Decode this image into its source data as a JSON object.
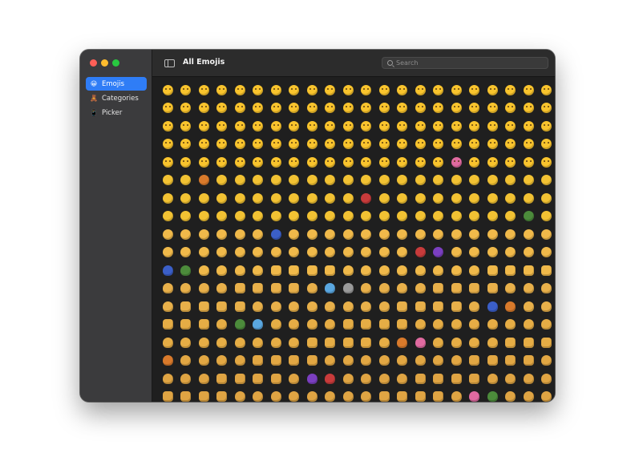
{
  "window": {
    "traffic_lights": [
      "close",
      "minimize",
      "zoom"
    ]
  },
  "sidebar": {
    "items": [
      {
        "label": "Emojis",
        "icon": "grinning-face-icon",
        "glyph": "😀",
        "active": true
      },
      {
        "label": "Categories",
        "icon": "teddy-bear-icon",
        "glyph": "🧸",
        "active": false
      },
      {
        "label": "Picker",
        "icon": "phone-icon",
        "glyph": "📱",
        "active": false
      }
    ]
  },
  "toolbar": {
    "title": "All Emojis",
    "sidebar_toggle_icon": "sidebar-toggle-icon",
    "search": {
      "placeholder": "Search",
      "value": "",
      "icon": "search-icon"
    }
  },
  "grid": {
    "columns": 22,
    "row_colors": [
      "#f9c42d",
      "#f9c42d",
      "#f9c42d",
      "#f9c42d",
      "#f9c42d",
      "#f2c233",
      "#f2c233",
      "#f2c233",
      "#f0b94a",
      "#f0b94a",
      "#f0b94a",
      "#e8b04a",
      "#e8b04a",
      "#e6ad45",
      "#e6ad45",
      "#e2a743",
      "#dfa443",
      "#dfa443",
      "#d9a046"
    ],
    "accent_colors": [
      "#7b3fc0",
      "#c83b3b",
      "#5aa7e0",
      "#4c8b3b",
      "#e06aa0",
      "#9a9a9a",
      "#3b5fc8",
      "#d97a2b"
    ]
  },
  "colors": {
    "accent": "#2f7df6",
    "sidebar": "#3b3b3d",
    "content": "#1f1f1f",
    "toolbar": "#2c2c2c"
  }
}
